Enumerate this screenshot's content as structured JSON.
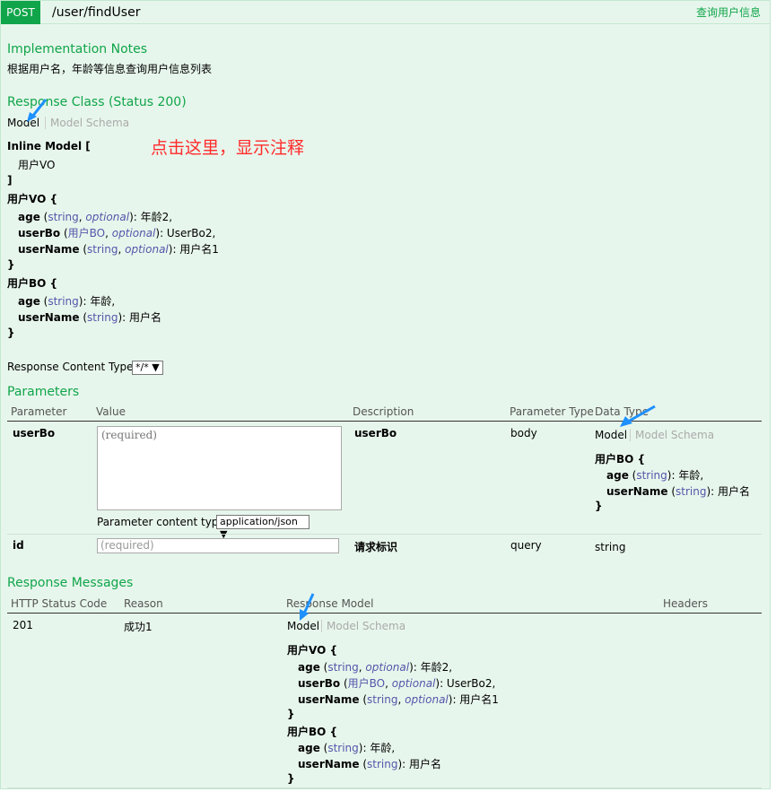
{
  "operation": {
    "method": "POST",
    "path": "/user/findUser",
    "summary": "查询用户信息"
  },
  "implementation": {
    "heading": "Implementation Notes",
    "notes": "根据用户名，年龄等信息查询用户信息列表"
  },
  "response_class": {
    "heading": "Response Class (Status 200)",
    "tab_model": "Model",
    "tab_schema": "Model Schema",
    "annotation": "点击这里，显示注释",
    "inline_model_open": "Inline Model [",
    "inline_item": "用户VO",
    "inline_close": "]",
    "vo_title": "用户VO {",
    "vo_age_name": "age",
    "vo_age_type": "string",
    "vo_age_opt": "optional",
    "vo_age_desc": ": 年龄2,",
    "vo_userbo_name": "userBo",
    "vo_userbo_type": "用户BO",
    "vo_userbo_opt": "optional",
    "vo_userbo_desc": ": UserBo2,",
    "vo_username_name": "userName",
    "vo_username_type": "string",
    "vo_username_opt": "optional",
    "vo_username_desc": ": 用户名1",
    "close_brace": "}",
    "bo_title": "用户BO {",
    "bo_age_name": "age",
    "bo_age_type": "string",
    "bo_age_desc": ": 年龄,",
    "bo_username_name": "userName",
    "bo_username_type": "string",
    "bo_username_desc": ": 用户名"
  },
  "content_type": {
    "label": "Response Content Type",
    "value": "*/*"
  },
  "parameters": {
    "heading": "Parameters",
    "headers": [
      "Parameter",
      "Value",
      "Description",
      "Parameter Type",
      "Data Type"
    ],
    "row1": {
      "name": "userBo",
      "placeholder": "(required)",
      "description": "userBo",
      "param_type": "body",
      "tab_model": "Model",
      "tab_schema": "Model Schema",
      "bo_title": "用户BO {",
      "age_name": "age",
      "age_type": "string",
      "age_desc": ": 年龄,",
      "username_name": "userName",
      "username_type": "string",
      "username_desc": ": 用户名",
      "close_brace": "}",
      "content_type_label": "Parameter content type:",
      "content_type_value": "application/json"
    },
    "row2": {
      "name": "id",
      "placeholder": "(required)",
      "description": "请求标识",
      "param_type": "query",
      "data_type": "string"
    }
  },
  "response_messages": {
    "heading": "Response Messages",
    "headers": [
      "HTTP Status Code",
      "Reason",
      "Response Model",
      "Headers"
    ],
    "row": {
      "code": "201",
      "reason": "成功1",
      "tab_model": "Model",
      "tab_schema": "Model Schema",
      "vo_title": "用户VO {",
      "age_name": "age",
      "age_type": "string",
      "age_opt": "optional",
      "age_desc": ": 年龄2,",
      "userbo_name": "userBo",
      "userbo_type": "用户BO",
      "userbo_opt": "optional",
      "userbo_desc": ": UserBo2,",
      "username_name": "userName",
      "username_type": "string",
      "username_opt": "optional",
      "username_desc": ": 用户名1",
      "close_brace": "}",
      "bo_title": "用户BO {",
      "bo_age_name": "age",
      "bo_age_type": "string",
      "bo_age_desc": ": 年龄,",
      "bo_username_name": "userName",
      "bo_username_type": "string",
      "bo_username_desc": ": 用户名"
    }
  },
  "colors": {
    "method_bg": "#10a54a",
    "panel_bg": "#e7f6ec",
    "annotation": "#ff2b2b",
    "arrow": "#1e90ff"
  }
}
